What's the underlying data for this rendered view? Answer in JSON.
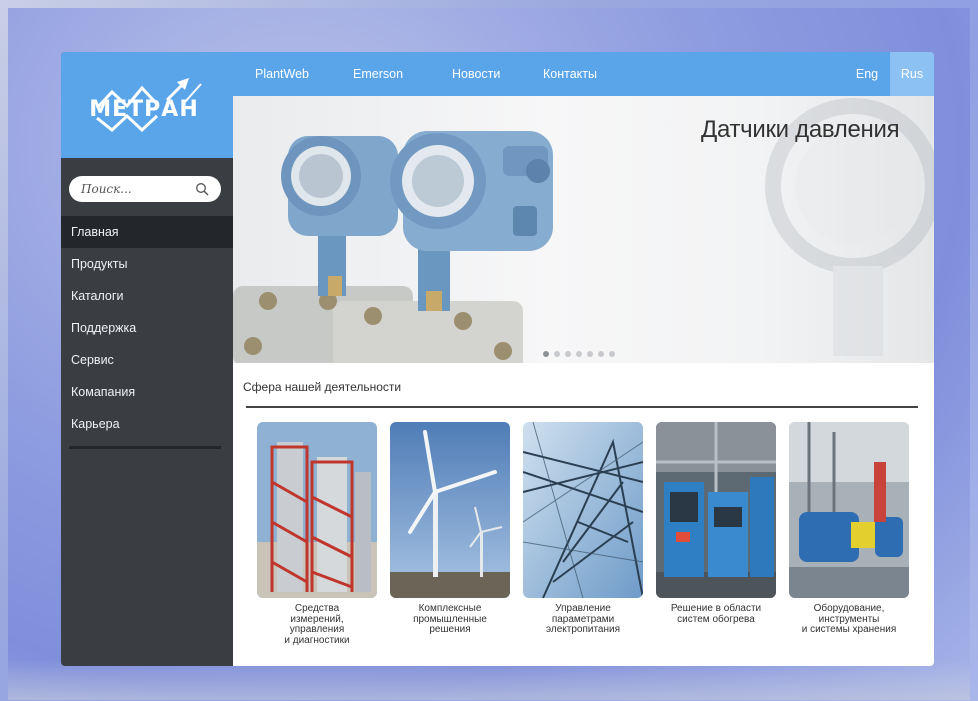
{
  "sidebar": {
    "logo_text": "МЕТРАН",
    "search_placeholder": "Поиск...",
    "items": [
      {
        "label": "Главная",
        "active": true
      },
      {
        "label": "Продукты"
      },
      {
        "label": "Каталоги"
      },
      {
        "label": "Поддержка"
      },
      {
        "label": "Сервис"
      },
      {
        "label": "Комапания"
      },
      {
        "label": "Карьера"
      }
    ]
  },
  "topnav": {
    "links": [
      "PlantWeb",
      "Emerson",
      "Новости",
      "Контакты"
    ],
    "lang_eng": "Eng",
    "lang_rus": "Rus"
  },
  "banner": {
    "title": "Датчики давления",
    "slide_count": 7,
    "active_slide": 0
  },
  "section": {
    "title": "Сфера нашей деятельности",
    "cards": [
      {
        "label": "Средства\nизмерений,\nуправления\nи диагностики"
      },
      {
        "label": "Комплексные\nпромышленные\nрешения"
      },
      {
        "label": "Управление\nпараметрами\nэлектропитания"
      },
      {
        "label": "Решение в области\nсистем обогрева"
      },
      {
        "label": "Оборудование,\nинструменты\nи системы хранения"
      }
    ]
  },
  "colors": {
    "accent": "#5aa5ea",
    "active_lang": "#8cc2f3",
    "sidebar": "#3a3e43",
    "sidebar_active": "#23262a"
  }
}
